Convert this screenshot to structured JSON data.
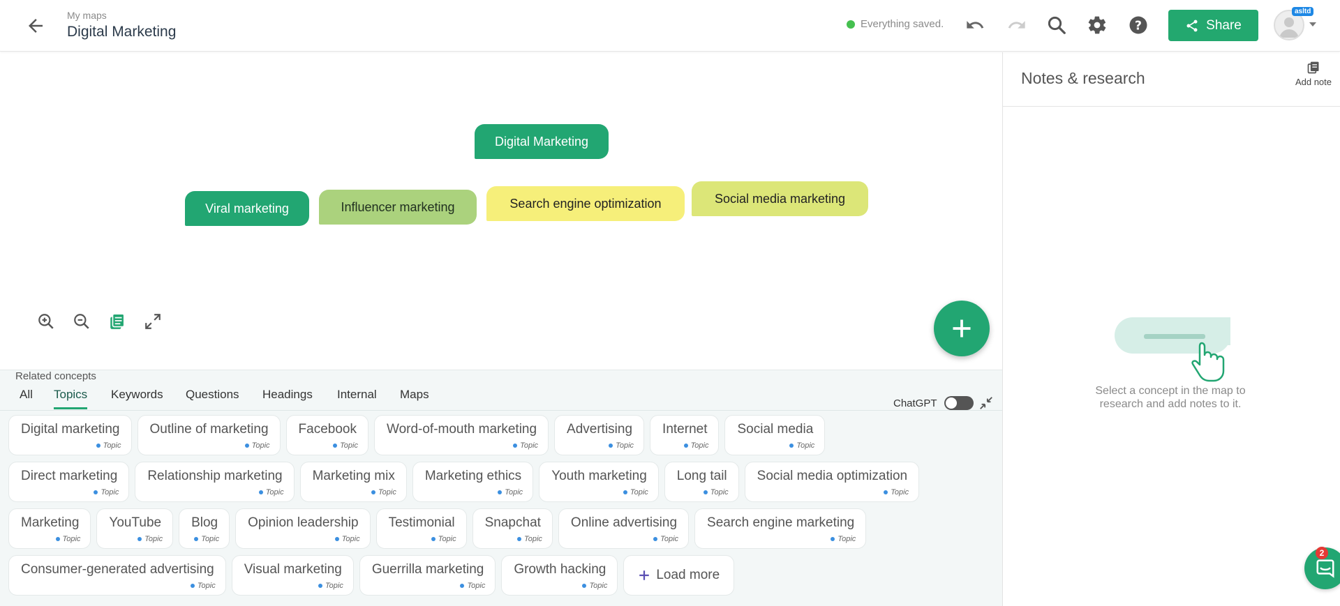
{
  "header": {
    "breadcrumb": "My maps",
    "title": "Digital Marketing",
    "save_status": "Everything saved.",
    "share_label": "Share",
    "user_badge": "asltd"
  },
  "colors": {
    "accent": "#22a672",
    "node_light_green": "#abd27d",
    "node_yellow": "#f6ef7a",
    "node_lime": "#dce678",
    "topic_dot": "#3b8fe0"
  },
  "map": {
    "root": "Digital Marketing",
    "children": [
      "Viral marketing",
      "Influencer marketing",
      "Search engine optimization",
      "Social media marketing"
    ]
  },
  "related": {
    "label": "Related concepts",
    "tabs": [
      "All",
      "Topics",
      "Keywords",
      "Questions",
      "Headings",
      "Internal",
      "Maps"
    ],
    "active_tab": "Topics",
    "chatgpt_label": "ChatGPT",
    "chatgpt_enabled": false,
    "type_label": "Topic",
    "rows": [
      [
        "Digital marketing",
        "Outline of marketing",
        "Facebook",
        "Word-of-mouth marketing",
        "Advertising",
        "Internet",
        "Social media"
      ],
      [
        "Direct marketing",
        "Relationship marketing",
        "Marketing mix",
        "Marketing ethics",
        "Youth marketing",
        "Long tail",
        "Social media optimization"
      ],
      [
        "Marketing",
        "YouTube",
        "Blog",
        "Opinion leadership",
        "Testimonial",
        "Snapchat",
        "Online advertising",
        "Search engine marketing"
      ],
      [
        "Consumer-generated advertising",
        "Visual marketing",
        "Guerrilla marketing",
        "Growth hacking"
      ]
    ],
    "load_more_label": "Load more"
  },
  "notes": {
    "title": "Notes & research",
    "add_note_label": "Add note",
    "hint": "Select a concept in the map to research and add notes to it."
  },
  "chat": {
    "unread_count": "2"
  }
}
